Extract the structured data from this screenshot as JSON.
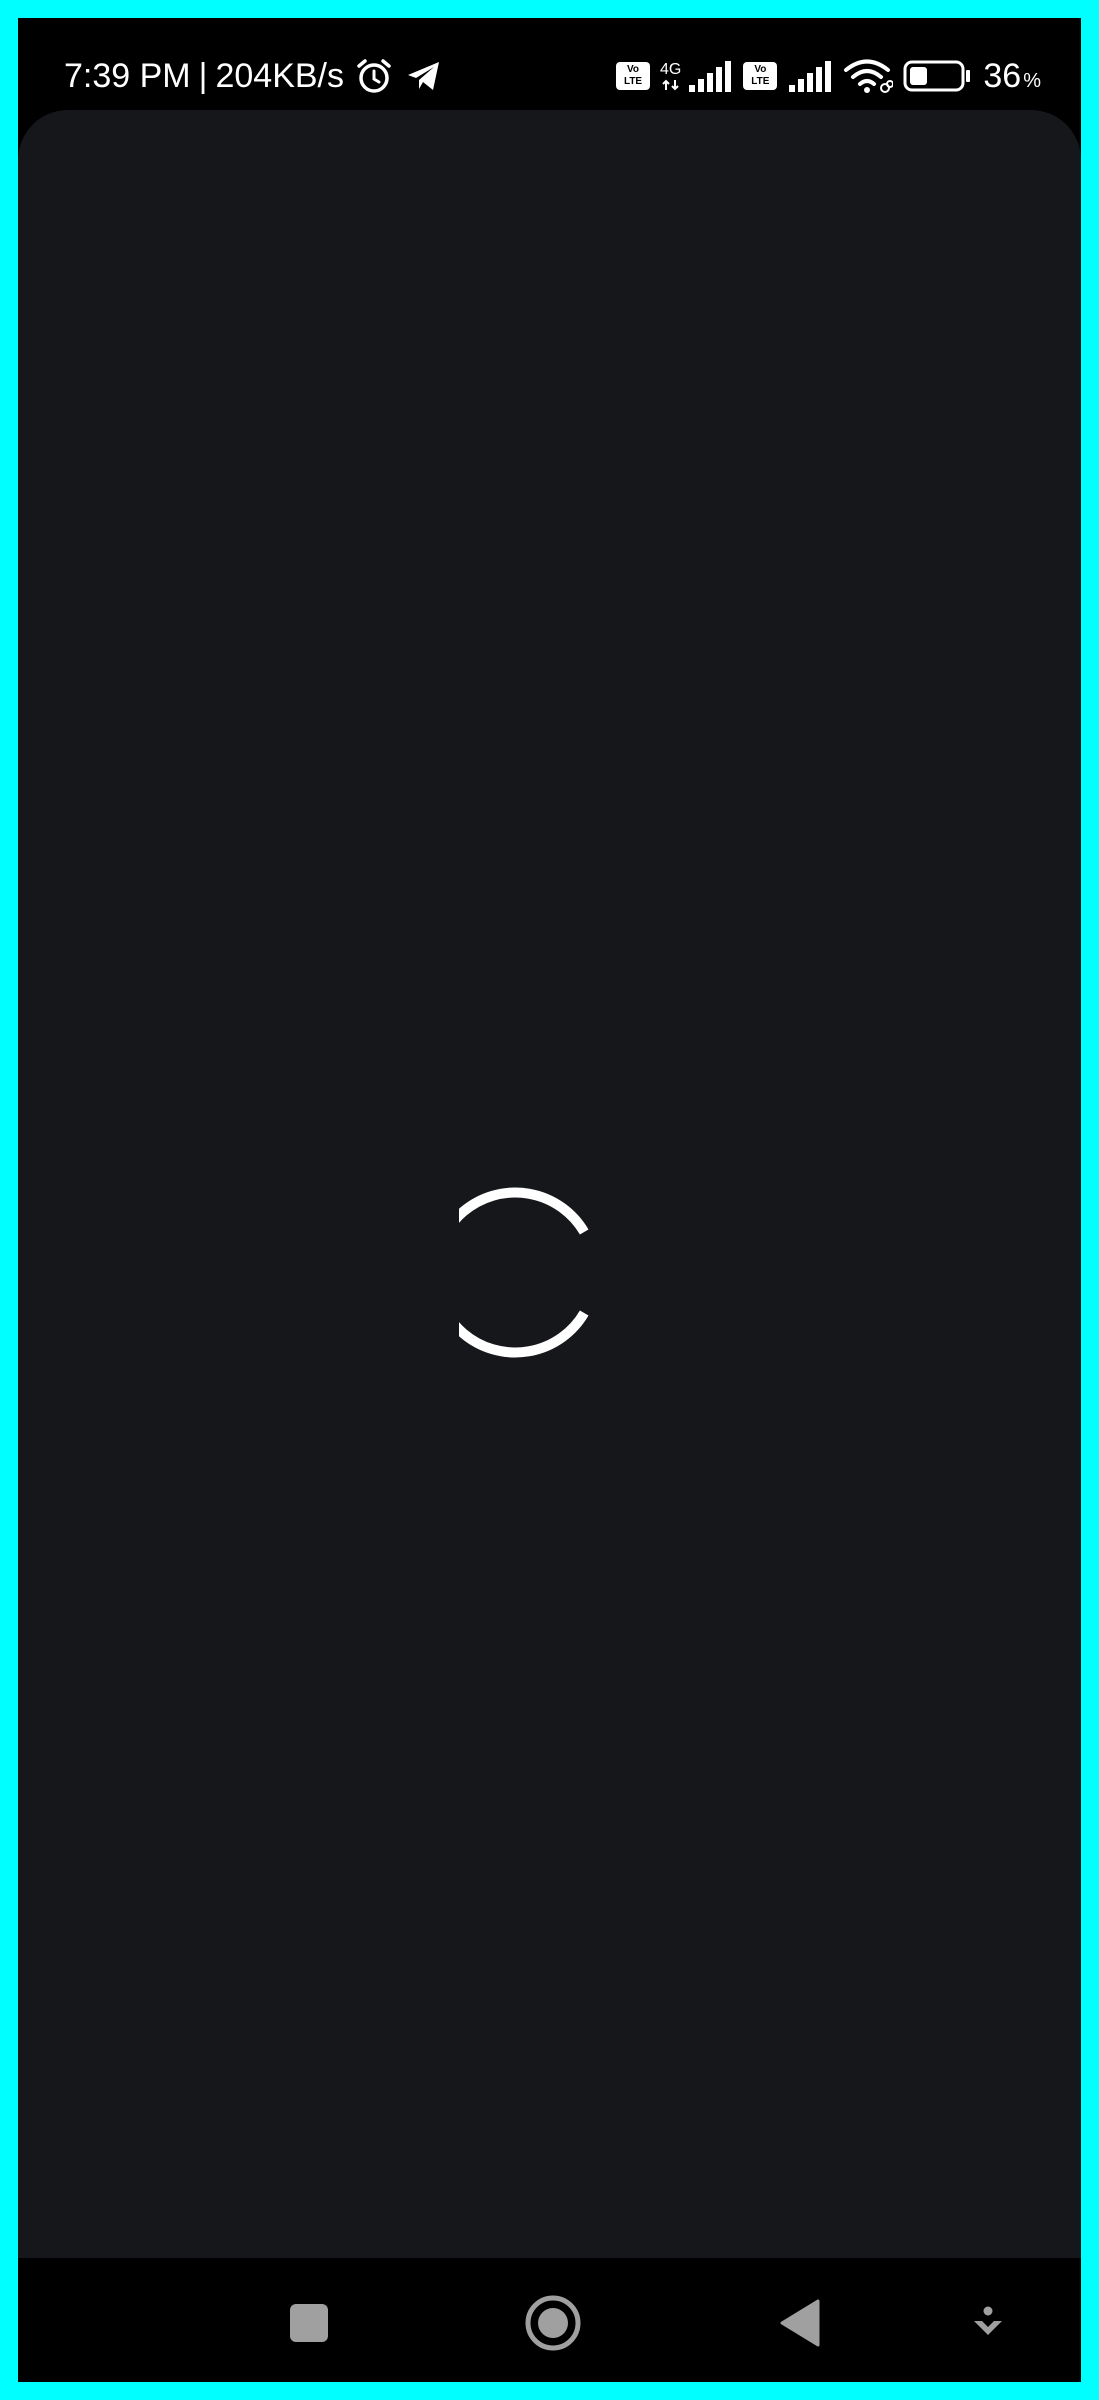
{
  "status_bar": {
    "time": "7:39 PM",
    "separator": "|",
    "net_speed": "204KB/s",
    "network_type": "4G",
    "volte_top": "Vo",
    "volte_bottom": "LTE",
    "battery_value": "36",
    "battery_unit": "%",
    "battery_level": 0.36,
    "icons": [
      "alarm-icon",
      "telegram-icon",
      "volte-icon",
      "signal-icon",
      "wifi-icon",
      "battery-icon"
    ]
  },
  "colors": {
    "frame_border": "#00ffff",
    "app_background": "#16171b",
    "system_bar": "#000000",
    "spinner": "#ffffff",
    "nav_icon": "#a0a0a0"
  },
  "nav_bar": {
    "icons": [
      "recents-icon",
      "home-icon",
      "back-icon",
      "accessibility-icon"
    ]
  }
}
